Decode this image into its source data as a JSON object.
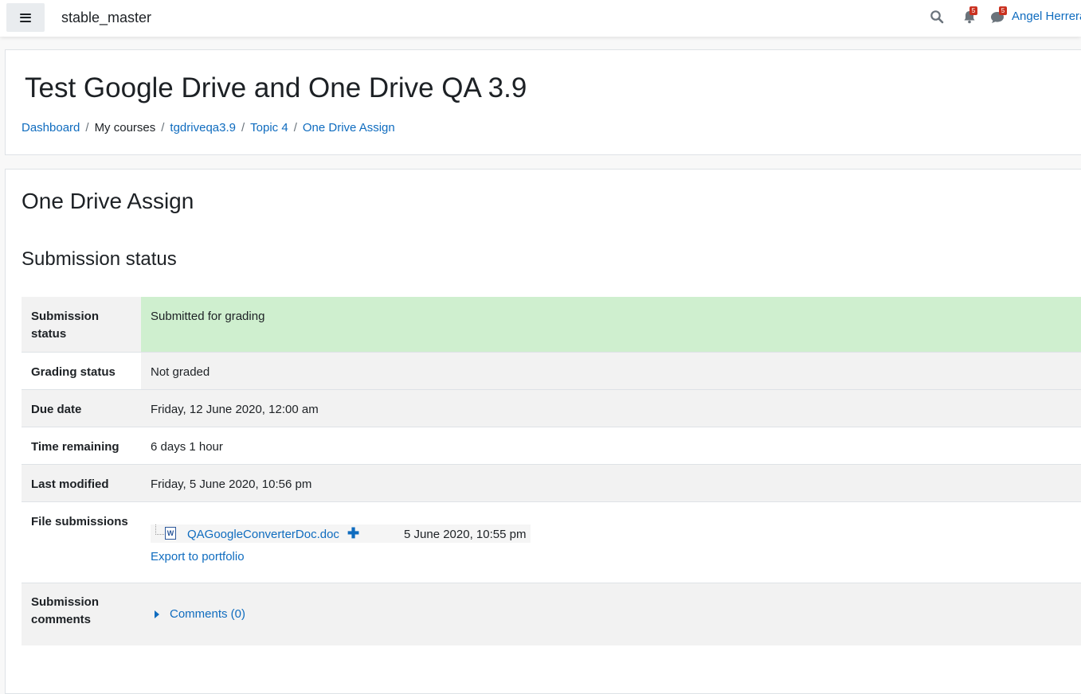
{
  "navbar": {
    "site_name": "stable_master",
    "notifications_count": "5",
    "messages_count": "5",
    "user_name": "Angel Herrera"
  },
  "header": {
    "page_title": "Test Google Drive and One Drive QA 3.9",
    "breadcrumb": [
      "Dashboard",
      "My courses",
      "tgdriveqa3.9",
      "Topic 4",
      "One Drive Assign"
    ]
  },
  "main": {
    "activity_title": "One Drive Assign",
    "section_title": "Submission status",
    "rows": {
      "submission_status": {
        "label": "Submission status",
        "value": "Submitted for grading"
      },
      "grading_status": {
        "label": "Grading status",
        "value": "Not graded"
      },
      "due_date": {
        "label": "Due date",
        "value": "Friday, 12 June 2020, 12:00 am"
      },
      "time_remaining": {
        "label": "Time remaining",
        "value": "6 days 1 hour"
      },
      "last_modified": {
        "label": "Last modified",
        "value": "Friday, 5 June 2020, 10:56 pm"
      },
      "file_submissions": {
        "label": "File submissions",
        "file_name": "QAGoogleConverterDoc.doc",
        "file_date": "5 June 2020, 10:55 pm",
        "export_label": "Export to portfolio",
        "file_icon_letter": "W"
      },
      "submission_comments": {
        "label": "Submission comments",
        "comments_label": "Comments (0)"
      }
    }
  },
  "colors": {
    "link": "#0f6cbf",
    "submitted_bg": "#cfefcf",
    "badge": "#ca3120"
  }
}
